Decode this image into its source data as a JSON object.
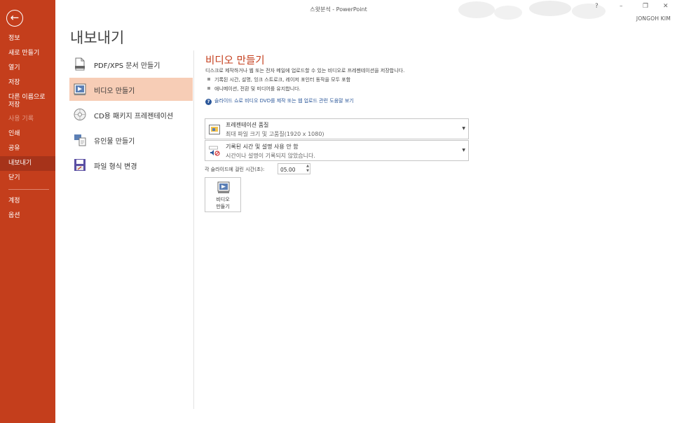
{
  "window": {
    "title": "스왓분석 - PowerPoint",
    "help": "?",
    "minimize": "–",
    "restore": "❐",
    "close": "✕",
    "user": "JONGOH KIM"
  },
  "sidebar": {
    "back": "←",
    "items": [
      {
        "label": "정보"
      },
      {
        "label": "새로 만들기"
      },
      {
        "label": "열기"
      },
      {
        "label": "저장"
      },
      {
        "label": "다른 이름으로 저장"
      },
      {
        "label": "사용 기록"
      },
      {
        "label": "인쇄"
      },
      {
        "label": "공유"
      },
      {
        "label": "내보내기"
      },
      {
        "label": "닫기"
      },
      {
        "label": "계정"
      },
      {
        "label": "옵션"
      }
    ]
  },
  "page_title": "내보내기",
  "options": [
    {
      "label": "PDF/XPS 문서 만들기"
    },
    {
      "label": "비디오 만들기"
    },
    {
      "label": "CD용 패키지 프레젠테이션"
    },
    {
      "label": "유인물 만들기"
    },
    {
      "label": "파일 형식 변경"
    }
  ],
  "panel": {
    "title": "비디오 만들기",
    "description": "디스크로 제작하거나 웹 또는 전자 메일에 업로드할 수 있는 비디오로 프레젠테이션을 저장합니다.",
    "bullets": [
      "기록된 시간, 설명, 잉크 스트로크, 레이저 포인터 동작을 모두 포함",
      "애니메이션, 전환 및 미디어를 유지합니다."
    ],
    "help_link": "슬라이드 쇼로 비디오 DVD를 제작 또는 웹 업로드 관련 도움말 보기",
    "quality": {
      "main": "프레젠테이션 품질",
      "sub": "최대 파일 크기 및 고품질(1920 x 1080)"
    },
    "narration": {
      "main": "기록된 시간 및 설명 사용 안 함",
      "sub": "시간이나 설명이 기록되지 않았습니다."
    },
    "time_label": "각 슬라이드에 걸린 시간(초):",
    "time_value": "05.00",
    "create_button": {
      "line1": "비디오",
      "line2": "만들기"
    }
  }
}
